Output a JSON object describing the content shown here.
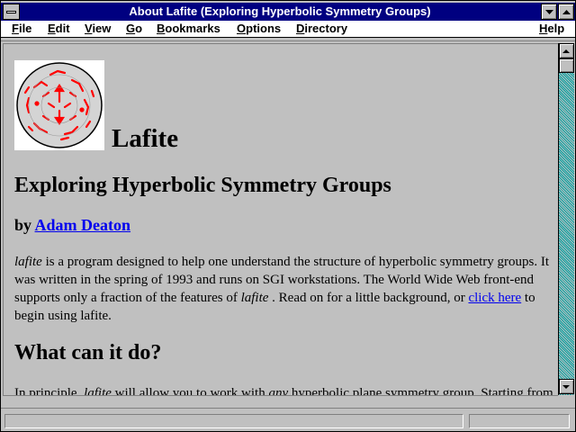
{
  "window": {
    "title": "About Lafite (Exploring Hyperbolic Symmetry Groups)"
  },
  "menubar": {
    "items": [
      {
        "label": "File",
        "accel": "F"
      },
      {
        "label": "Edit",
        "accel": "E"
      },
      {
        "label": "View",
        "accel": "V"
      },
      {
        "label": "Go",
        "accel": "G"
      },
      {
        "label": "Bookmarks",
        "accel": "B"
      },
      {
        "label": "Options",
        "accel": "O"
      },
      {
        "label": "Directory",
        "accel": "D"
      },
      {
        "label": "Help",
        "accel": "H"
      }
    ]
  },
  "page": {
    "heading": "Lafite",
    "subheading": "Exploring Hyperbolic Symmetry Groups",
    "by_prefix": "by",
    "author": "Adam Deaton",
    "intro": {
      "lafite_1": "lafite",
      "text_1": " is a program designed to help one understand the structure of hyperbolic symmetry groups. It was written in the spring of 1993 and runs on SGI workstations. The World Wide Web front-end supports only a fraction of the features of ",
      "lafite_2": "lafite",
      "text_2": " . Read on for a little background, or ",
      "link": "click here",
      "text_3": " to begin using lafite."
    },
    "section_heading": "What can it do?",
    "section_text": {
      "part_1": "In principle, ",
      "lafite": "lafite",
      "part_2": " will allow you to work with ",
      "any": "any",
      "part_3": " hyperbolic plane symmetry group. Starting from"
    }
  },
  "colors": {
    "titlebar": "#000080",
    "link": "#0000ee",
    "background": "#c0c0c0",
    "logo_motif": "#ff0000"
  },
  "icons": [
    "system-menu-icon",
    "minimize-icon",
    "maximize-icon",
    "scroll-up-icon",
    "scroll-down-icon",
    "hyperbolic-disk-logo"
  ]
}
